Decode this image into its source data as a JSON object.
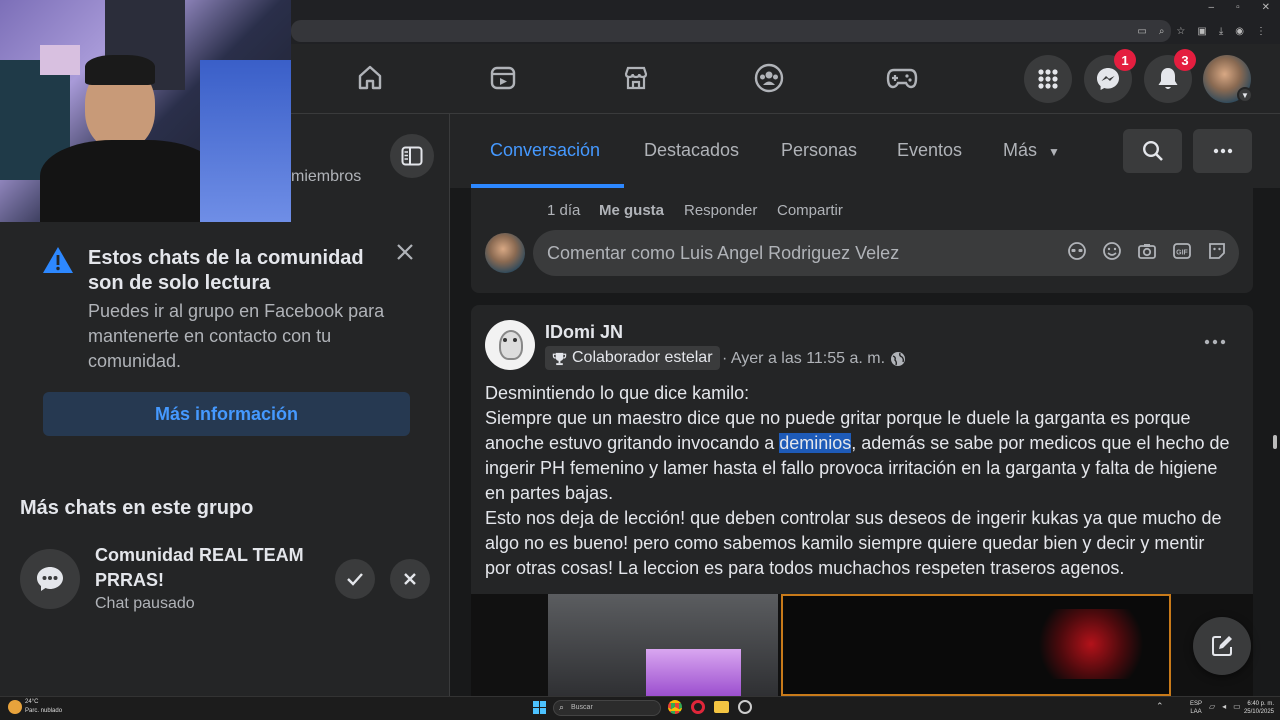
{
  "nav": {
    "messenger_badge": "1",
    "notif_badge": "3"
  },
  "left": {
    "members_text": "miembros",
    "readonly_title": "Estos chats de la comunidad son de solo lectura",
    "readonly_body": "Puedes ir al grupo en Facebook para mantenerte en contacto con tu comunidad.",
    "more_info_button": "Más información",
    "more_chats_heading": "Más chats en este grupo",
    "chat_name": "Comunidad REAL TEAM PRRAS!",
    "chat_status": "Chat pausado"
  },
  "tabs": [
    {
      "label": "Conversación"
    },
    {
      "label": "Destacados"
    },
    {
      "label": "Personas"
    },
    {
      "label": "Eventos"
    },
    {
      "label": "Más"
    }
  ],
  "comment_actions": {
    "time": "1 día",
    "like": "Me gusta",
    "reply": "Responder",
    "share": "Compartir"
  },
  "comment_box": {
    "placeholder": "Comentar como Luis Angel Rodriguez Velez"
  },
  "post": {
    "author": "IDomi JN",
    "badge": "Colaborador estelar",
    "time": "· Ayer a las 11:55 a. m. ·",
    "line1": "Desmintiendo lo que dice kamilo:",
    "para1_before": "Siempre que un maestro dice que no puede gritar porque le duele la garganta es porque anoche estuvo gritando invocando a ",
    "para1_highlight": "deminios",
    "para1_after": ", además se sabe por medicos que el hecho de ingerir PH femenino y lamer hasta el fallo provoca irritación en la garganta y falta de higiene en partes bajas.",
    "para2": "Esto nos deja de lección! que deben controlar sus deseos de ingerir kukas ya que mucho de algo no es bueno! pero como sabemos kamilo siempre quiere quedar bien y decir y mentir por otras cosas! La leccion es para todos muchachos respeten traseros agenos."
  },
  "taskbar": {
    "weather_temp": "24°C",
    "weather_desc": "Parc. nublado",
    "search_placeholder": "Buscar",
    "lang": "ESP",
    "lang2": "LAA",
    "clock_time": "6:40 p. m.",
    "clock_date": "25/10/2025"
  },
  "colors": {
    "accent": "#2d88ff",
    "badge": "#e41e3f",
    "surface": "#242526",
    "bg": "#18191a"
  }
}
